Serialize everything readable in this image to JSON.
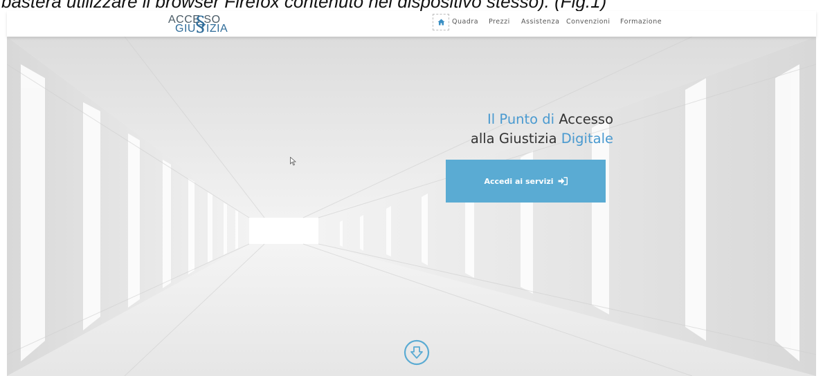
{
  "caption": {
    "text": "basterà utilizzare il browser Firefox contenuto nel dispositivo stesso). (Fig.1)"
  },
  "logo": {
    "line1": "ACCE  SO",
    "line2": "GIU  TIZIA",
    "symbol": "§"
  },
  "nav": {
    "home_icon": "home-icon",
    "items": [
      "Quadra",
      "Prezzi",
      "Assistenza",
      "Convenzioni",
      "Formazione"
    ]
  },
  "hero": {
    "line1_part1": "Il Punto di ",
    "line1_part2": "Accesso",
    "line2_part1": "alla Giustizia ",
    "line2_part2": "Digitale",
    "cta_label": "Accedi ai servizi",
    "cta_icon": "sign-in-icon",
    "scroll_icon": "arrow-down-circle-icon"
  },
  "colors": {
    "accent": "#5aabd3",
    "headline_blue": "#4a9ad0",
    "logo_blue": "#2f6c99"
  }
}
